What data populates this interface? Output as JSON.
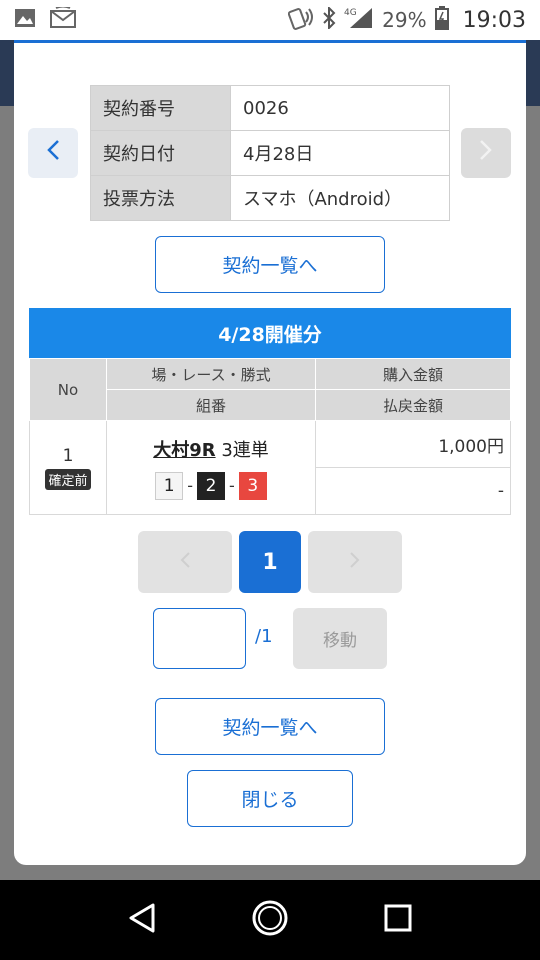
{
  "status_bar": {
    "battery": "29%",
    "time": "19:03",
    "icons": [
      "image-icon",
      "message-icon",
      "nfc-icon",
      "bluetooth-icon",
      "signal-4g-icon",
      "battery-icon"
    ]
  },
  "contract_info": {
    "rows": [
      {
        "label": "契約番号",
        "value": "0026"
      },
      {
        "label": "契約日付",
        "value": "4月28日"
      },
      {
        "label": "投票方法",
        "value": "スマホ（Android）"
      }
    ]
  },
  "buttons": {
    "contract_list_top": "契約一覧へ",
    "contract_list_bottom": "契約一覧へ",
    "close": "閉じる",
    "move": "移動"
  },
  "date_banner": "4/28開催分",
  "bet_table": {
    "headers": {
      "no": "No",
      "race_type": "場・レース・勝式",
      "combination": "組番",
      "purchase": "購入金額",
      "payout": "払戻金額"
    },
    "rows": [
      {
        "no": "1",
        "status": "確定前",
        "venue_race": "大村9R",
        "bet_type": "3連単",
        "combo": [
          "1",
          "2",
          "3"
        ],
        "purchase": "1,000円",
        "payout": "-"
      }
    ]
  },
  "pagination": {
    "current_page": "1",
    "total_pages": "/1",
    "prev": "‹",
    "next": "›"
  },
  "colors": {
    "accent": "#1a6fd4",
    "banner": "#1a88e8",
    "boat_2": "#222222",
    "boat_3": "#e8473f"
  }
}
